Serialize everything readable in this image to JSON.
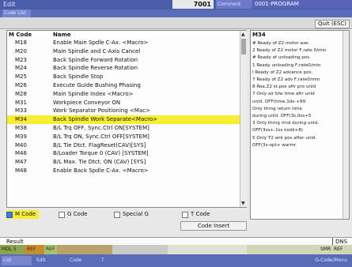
{
  "header": {
    "left_text": "Edit",
    "number": "7001",
    "program_label": "Comment",
    "program": "0001-PROGRAM",
    "sub_tag": "Code List"
  },
  "toolbar": {
    "quit_label": "Quit (ESC)"
  },
  "list": {
    "col_code": "M Code",
    "col_name": "Name",
    "rows": [
      {
        "code": "M18",
        "name": "Enable Main Spdle C-Ax. <Macro>"
      },
      {
        "code": "M20",
        "name": "Main Spindle and C-Axis Cancel"
      },
      {
        "code": "M23",
        "name": "Back Spindle Forward Rotation"
      },
      {
        "code": "M24",
        "name": "Back Spindle Reverse Rotation"
      },
      {
        "code": "M25",
        "name": "Back Spindle Stop"
      },
      {
        "code": "M26",
        "name": "Execute Guide Bushing Phasing"
      },
      {
        "code": "M28",
        "name": "Main Spindle Index <Macro>"
      },
      {
        "code": "M31",
        "name": "Workpiece Conveyor ON"
      },
      {
        "code": "M33",
        "name": "Work Separator Positioning <Mac>"
      },
      {
        "code": "M34",
        "name": "Back Spindle Work Separate<Macro>"
      },
      {
        "code": "M38",
        "name": "B/L Trq OFF, Sync.Ctrl ON[SYSTEM]"
      },
      {
        "code": "M39",
        "name": "B/L Trq ON, Sync.Ctrl OFF[SYSTEM]"
      },
      {
        "code": "M40",
        "name": "B/L Tie Dtct. FlagReset(CAV)[SYS]"
      },
      {
        "code": "M46",
        "name": "B/Loader Torque 0 (CAV) [SYSTEM]"
      },
      {
        "code": "M47",
        "name": "B/L Max. Tie Dtct. ON (CAV) [SYS]"
      },
      {
        "code": "M48",
        "name": "Enable Back Spdle C-Ax. <Macro>"
      }
    ],
    "selected_index": 9
  },
  "description": {
    "header": "M34",
    "lines": [
      "# Ready of Z2 motor axe.",
      "2 Ready of Z2 motor F,rate 0/min",
      "# Ready of unloading pos.",
      "1 Ready unloading F,rate0/min",
      "I Ready of Z2 advance pos.",
      "7 Ready of Z2 adv F,rate0/min",
      "8 Rea.Z2 st.pos aftr pro unld",
      "7 Only air blw time aftr unld",
      "   unld. OFF(time,1ds-+99",
      "   Only thrng return time",
      "   during unld. OFF(3s,0ss+5",
      "3 Only thrng rtnd during unld.",
      "   OFF(3ss+-1ss ksdd+8)",
      "5 Only T2 wrk pos after unld.",
      "   OFF(3s-opt+ warmr"
    ]
  },
  "filters": {
    "m_code": "M Code",
    "g_code": "G Code",
    "special": "Special G",
    "t_code": "T Code",
    "active": "m_code"
  },
  "code_insert_label": "Code Insert",
  "result": {
    "label": "Result",
    "right": "DNS"
  },
  "status": {
    "a": "MDL 5",
    "b": "REF",
    "c": "REF",
    "h": "SMR",
    "g": "REF"
  },
  "function_keys": [
    "List",
    "Edit",
    "Code",
    "T"
  ],
  "function_key_right": "G-Code/Menu"
}
